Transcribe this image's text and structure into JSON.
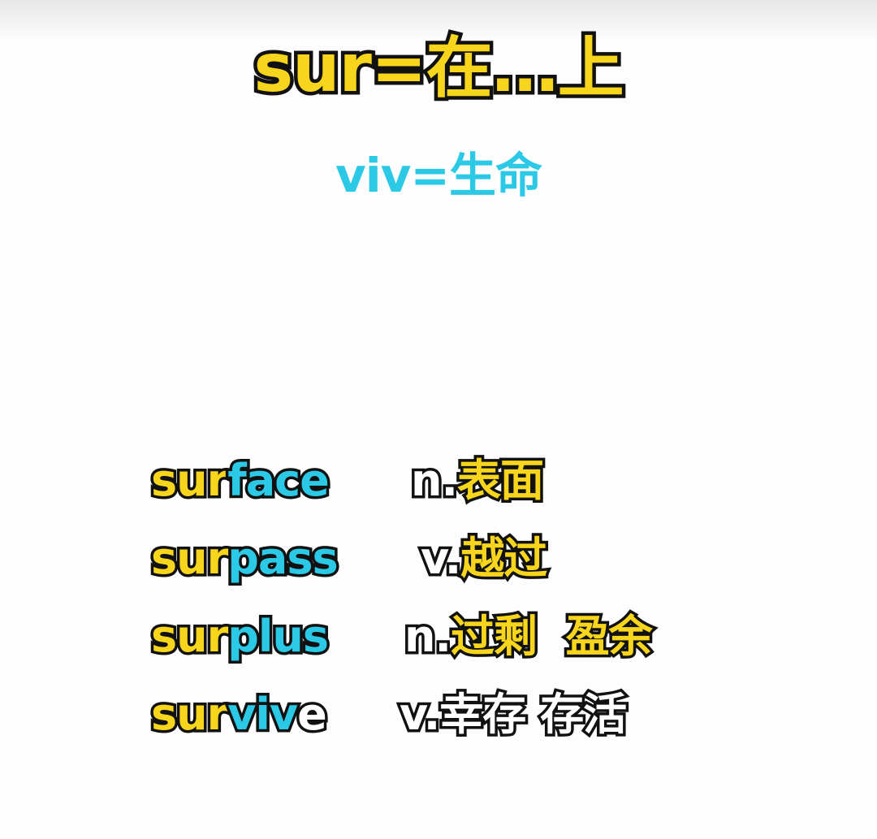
{
  "colors": {
    "yellow": "#f7d51d",
    "cyan": "#2cc9e6",
    "white": "#ffffff",
    "outline": "#111111"
  },
  "title": {
    "prefix": "sur",
    "rest": "=在…上"
  },
  "subtitle": "viv=生命",
  "words": [
    {
      "prefix": "sur",
      "stem": "face",
      "suffix": "",
      "pos": "n.",
      "meaning": "表面"
    },
    {
      "prefix": "sur",
      "stem": "pass",
      "suffix": "",
      "pos": "v.",
      "meaning": "越过"
    },
    {
      "prefix": "sur",
      "stem": "plus",
      "suffix": "",
      "pos": "n.",
      "meaning": "过剩  盈余"
    },
    {
      "prefix": "sur",
      "stem": "viv",
      "suffix": "e",
      "pos": "v.",
      "meaning": "幸存 存活"
    }
  ]
}
